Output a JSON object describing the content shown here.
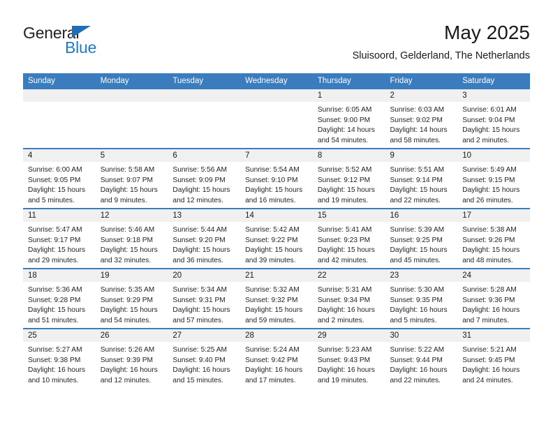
{
  "brand": {
    "name_part1": "General",
    "name_part2": "Blue",
    "triangle_color": "#1f6fb5",
    "blue_text_color": "#1f7ac4"
  },
  "header": {
    "title": "May 2025",
    "subtitle": "Sluisoord, Gelderland, The Netherlands"
  },
  "colors": {
    "header_row_bg": "#3a7cbe",
    "day_band_bg": "#f0f0f0",
    "week_divider": "#3a7cbe",
    "text": "#231f20"
  },
  "weekdays": [
    "Sunday",
    "Monday",
    "Tuesday",
    "Wednesday",
    "Thursday",
    "Friday",
    "Saturday"
  ],
  "weeks": [
    [
      {
        "day": "",
        "sunrise": "",
        "sunset": "",
        "daylight": "",
        "empty": true
      },
      {
        "day": "",
        "sunrise": "",
        "sunset": "",
        "daylight": "",
        "empty": true
      },
      {
        "day": "",
        "sunrise": "",
        "sunset": "",
        "daylight": "",
        "empty": true
      },
      {
        "day": "",
        "sunrise": "",
        "sunset": "",
        "daylight": "",
        "empty": true
      },
      {
        "day": "1",
        "sunrise": "Sunrise: 6:05 AM",
        "sunset": "Sunset: 9:00 PM",
        "daylight": "Daylight: 14 hours and 54 minutes."
      },
      {
        "day": "2",
        "sunrise": "Sunrise: 6:03 AM",
        "sunset": "Sunset: 9:02 PM",
        "daylight": "Daylight: 14 hours and 58 minutes."
      },
      {
        "day": "3",
        "sunrise": "Sunrise: 6:01 AM",
        "sunset": "Sunset: 9:04 PM",
        "daylight": "Daylight: 15 hours and 2 minutes."
      }
    ],
    [
      {
        "day": "4",
        "sunrise": "Sunrise: 6:00 AM",
        "sunset": "Sunset: 9:05 PM",
        "daylight": "Daylight: 15 hours and 5 minutes."
      },
      {
        "day": "5",
        "sunrise": "Sunrise: 5:58 AM",
        "sunset": "Sunset: 9:07 PM",
        "daylight": "Daylight: 15 hours and 9 minutes."
      },
      {
        "day": "6",
        "sunrise": "Sunrise: 5:56 AM",
        "sunset": "Sunset: 9:09 PM",
        "daylight": "Daylight: 15 hours and 12 minutes."
      },
      {
        "day": "7",
        "sunrise": "Sunrise: 5:54 AM",
        "sunset": "Sunset: 9:10 PM",
        "daylight": "Daylight: 15 hours and 16 minutes."
      },
      {
        "day": "8",
        "sunrise": "Sunrise: 5:52 AM",
        "sunset": "Sunset: 9:12 PM",
        "daylight": "Daylight: 15 hours and 19 minutes."
      },
      {
        "day": "9",
        "sunrise": "Sunrise: 5:51 AM",
        "sunset": "Sunset: 9:14 PM",
        "daylight": "Daylight: 15 hours and 22 minutes."
      },
      {
        "day": "10",
        "sunrise": "Sunrise: 5:49 AM",
        "sunset": "Sunset: 9:15 PM",
        "daylight": "Daylight: 15 hours and 26 minutes."
      }
    ],
    [
      {
        "day": "11",
        "sunrise": "Sunrise: 5:47 AM",
        "sunset": "Sunset: 9:17 PM",
        "daylight": "Daylight: 15 hours and 29 minutes."
      },
      {
        "day": "12",
        "sunrise": "Sunrise: 5:46 AM",
        "sunset": "Sunset: 9:18 PM",
        "daylight": "Daylight: 15 hours and 32 minutes."
      },
      {
        "day": "13",
        "sunrise": "Sunrise: 5:44 AM",
        "sunset": "Sunset: 9:20 PM",
        "daylight": "Daylight: 15 hours and 36 minutes."
      },
      {
        "day": "14",
        "sunrise": "Sunrise: 5:42 AM",
        "sunset": "Sunset: 9:22 PM",
        "daylight": "Daylight: 15 hours and 39 minutes."
      },
      {
        "day": "15",
        "sunrise": "Sunrise: 5:41 AM",
        "sunset": "Sunset: 9:23 PM",
        "daylight": "Daylight: 15 hours and 42 minutes."
      },
      {
        "day": "16",
        "sunrise": "Sunrise: 5:39 AM",
        "sunset": "Sunset: 9:25 PM",
        "daylight": "Daylight: 15 hours and 45 minutes."
      },
      {
        "day": "17",
        "sunrise": "Sunrise: 5:38 AM",
        "sunset": "Sunset: 9:26 PM",
        "daylight": "Daylight: 15 hours and 48 minutes."
      }
    ],
    [
      {
        "day": "18",
        "sunrise": "Sunrise: 5:36 AM",
        "sunset": "Sunset: 9:28 PM",
        "daylight": "Daylight: 15 hours and 51 minutes."
      },
      {
        "day": "19",
        "sunrise": "Sunrise: 5:35 AM",
        "sunset": "Sunset: 9:29 PM",
        "daylight": "Daylight: 15 hours and 54 minutes."
      },
      {
        "day": "20",
        "sunrise": "Sunrise: 5:34 AM",
        "sunset": "Sunset: 9:31 PM",
        "daylight": "Daylight: 15 hours and 57 minutes."
      },
      {
        "day": "21",
        "sunrise": "Sunrise: 5:32 AM",
        "sunset": "Sunset: 9:32 PM",
        "daylight": "Daylight: 15 hours and 59 minutes."
      },
      {
        "day": "22",
        "sunrise": "Sunrise: 5:31 AM",
        "sunset": "Sunset: 9:34 PM",
        "daylight": "Daylight: 16 hours and 2 minutes."
      },
      {
        "day": "23",
        "sunrise": "Sunrise: 5:30 AM",
        "sunset": "Sunset: 9:35 PM",
        "daylight": "Daylight: 16 hours and 5 minutes."
      },
      {
        "day": "24",
        "sunrise": "Sunrise: 5:28 AM",
        "sunset": "Sunset: 9:36 PM",
        "daylight": "Daylight: 16 hours and 7 minutes."
      }
    ],
    [
      {
        "day": "25",
        "sunrise": "Sunrise: 5:27 AM",
        "sunset": "Sunset: 9:38 PM",
        "daylight": "Daylight: 16 hours and 10 minutes."
      },
      {
        "day": "26",
        "sunrise": "Sunrise: 5:26 AM",
        "sunset": "Sunset: 9:39 PM",
        "daylight": "Daylight: 16 hours and 12 minutes."
      },
      {
        "day": "27",
        "sunrise": "Sunrise: 5:25 AM",
        "sunset": "Sunset: 9:40 PM",
        "daylight": "Daylight: 16 hours and 15 minutes."
      },
      {
        "day": "28",
        "sunrise": "Sunrise: 5:24 AM",
        "sunset": "Sunset: 9:42 PM",
        "daylight": "Daylight: 16 hours and 17 minutes."
      },
      {
        "day": "29",
        "sunrise": "Sunrise: 5:23 AM",
        "sunset": "Sunset: 9:43 PM",
        "daylight": "Daylight: 16 hours and 19 minutes."
      },
      {
        "day": "30",
        "sunrise": "Sunrise: 5:22 AM",
        "sunset": "Sunset: 9:44 PM",
        "daylight": "Daylight: 16 hours and 22 minutes."
      },
      {
        "day": "31",
        "sunrise": "Sunrise: 5:21 AM",
        "sunset": "Sunset: 9:45 PM",
        "daylight": "Daylight: 16 hours and 24 minutes."
      }
    ]
  ]
}
